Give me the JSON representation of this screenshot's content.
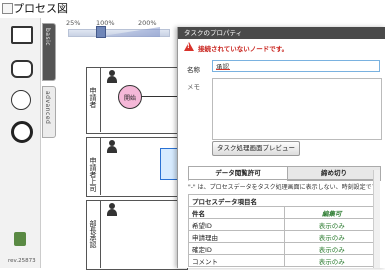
{
  "title": "プロセス図",
  "zoom": {
    "ticks": [
      "25%",
      "100%",
      "200%"
    ],
    "level_percent": 100
  },
  "palette": {
    "tabs": [
      "basic",
      "advanced"
    ],
    "revision": "rev.25873"
  },
  "lanes": [
    "申請者",
    "申請者上司",
    "部長承認"
  ],
  "start_node_label": "開始",
  "dialog": {
    "title": "タスクのプロパティ",
    "warning": "接続されていないノードです。",
    "name_label": "名称",
    "name_value": "承認",
    "memo_label": "メモ",
    "preview_button": "タスク処理画面プレビュー",
    "tabs": [
      "データ閲覧許可",
      "締め切り"
    ],
    "hint": "\"-\" は、プロセスデータをタスク処理画面に表示しない、時刻設定です。",
    "table": {
      "header": "プロセスデータ項目名",
      "rows": [
        {
          "name": "件名",
          "perm": "編集可"
        },
        {
          "name": "希望ID",
          "perm": "表示のみ"
        },
        {
          "name": "申請理由",
          "perm": "表示のみ"
        },
        {
          "name": "確定ID",
          "perm": "表示のみ"
        },
        {
          "name": "コメント",
          "perm": "表示のみ"
        }
      ]
    }
  },
  "colors": {
    "warning": "#c8201a",
    "permission": "#2e7d32",
    "start_node": "#f5b8d8"
  }
}
